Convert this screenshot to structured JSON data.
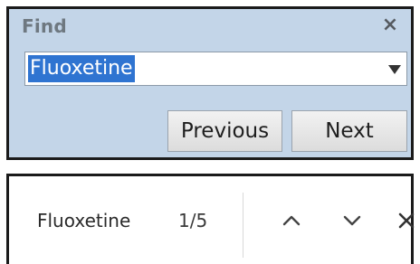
{
  "find_dialog": {
    "title": "Find",
    "close_glyph": "×",
    "search_value": "Fluoxetine",
    "previous_label": "Previous",
    "next_label": "Next",
    "selection_color": "#2f74d1",
    "background_color": "#c3d5e8"
  },
  "find_bar": {
    "query": "Fluoxetine",
    "match_count": "1/5",
    "icons": {
      "previous": "chevron-up-icon",
      "next": "chevron-down-icon",
      "close": "close-icon"
    }
  }
}
